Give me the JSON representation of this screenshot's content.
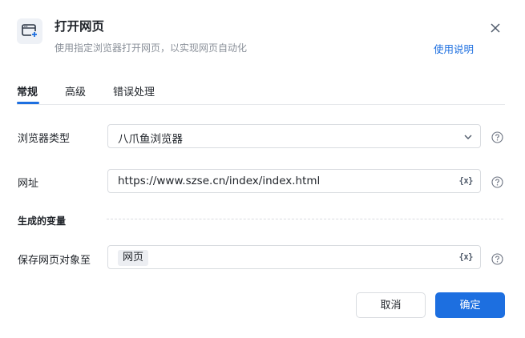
{
  "header": {
    "icon": "browser-open-icon",
    "title": "打开网页",
    "subtitle": "使用指定浏览器打开网页，以实现网页自动化",
    "help_link": "使用说明",
    "close_icon": "close-icon"
  },
  "tabs": [
    {
      "label": "常规",
      "active": true
    },
    {
      "label": "高级",
      "active": false
    },
    {
      "label": "错误处理",
      "active": false
    }
  ],
  "form": {
    "browser_type": {
      "label": "浏览器类型",
      "value": "八爪鱼浏览器"
    },
    "url": {
      "label": "网址",
      "value": "https://www.szse.cn/index/index.html",
      "var_icon": "{x}"
    },
    "generated_vars": {
      "title": "生成的变量"
    },
    "save_page": {
      "label": "保存网页对象至",
      "tag": "网页",
      "var_icon": "{x}"
    }
  },
  "footer": {
    "cancel_label": "取消",
    "ok_label": "确定"
  },
  "colors": {
    "accent": "#1d6fe0",
    "muted_text": "#8a9099",
    "border": "#d9dce0"
  }
}
